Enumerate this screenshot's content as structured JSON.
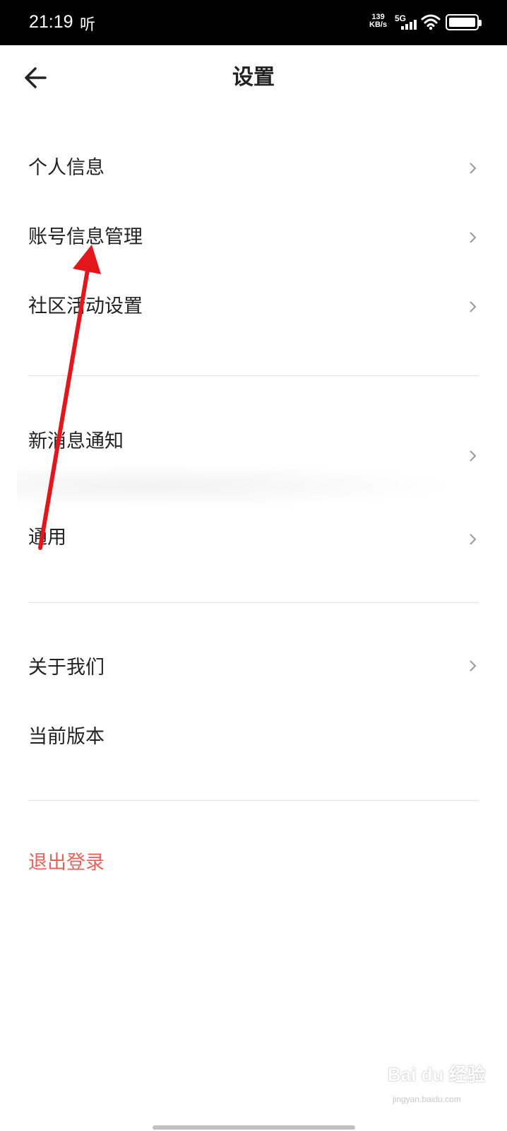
{
  "status_bar": {
    "time": "21:19",
    "app_indicator": "听",
    "net_speed_value": "139",
    "net_speed_unit": "KB/s",
    "network_type": "5G",
    "icons": [
      "signal-icon",
      "wifi-icon",
      "battery-icon"
    ]
  },
  "header": {
    "title": "设置",
    "back_icon": "back-arrow-icon"
  },
  "sections": [
    {
      "items": [
        {
          "label": "个人信息",
          "chevron": true
        },
        {
          "label": "账号信息管理",
          "chevron": true
        },
        {
          "label": "社区活动设置",
          "chevron": true
        }
      ]
    },
    {
      "items": [
        {
          "label": "新消息通知",
          "chevron": true
        },
        {
          "label": "通用",
          "chevron": true
        }
      ]
    },
    {
      "items": [
        {
          "label": "关于我们",
          "chevron": true
        },
        {
          "label": "当前版本",
          "chevron": false
        }
      ]
    }
  ],
  "logout_label": "退出登录",
  "colors": {
    "logout": "#e8625b",
    "annotation_arrow": "#e3161b",
    "status_bar_bg": "#000000"
  },
  "watermark": {
    "brand": "Bai du 经验",
    "url": "jingyan.baidu.com"
  }
}
